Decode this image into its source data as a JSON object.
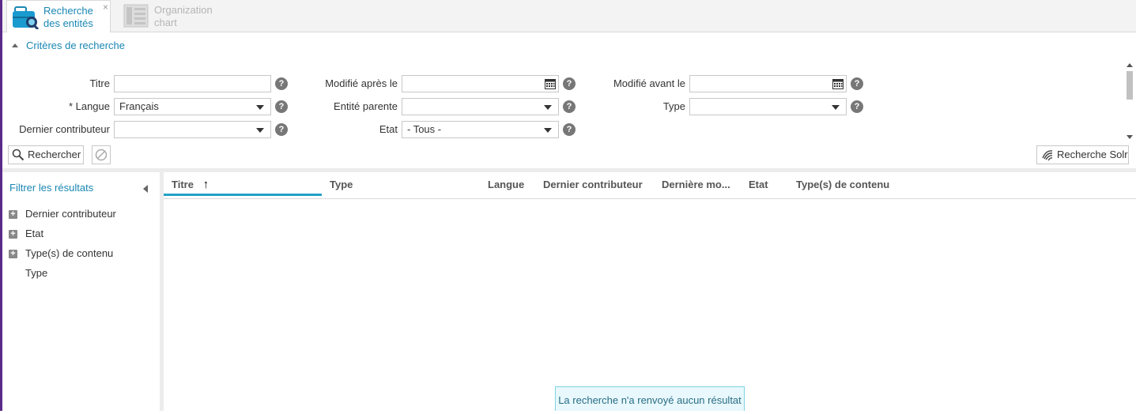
{
  "tabs": [
    {
      "label_line1": "Recherche",
      "label_line2": "des entités",
      "close": "×"
    },
    {
      "label_line1": "Organization",
      "label_line2": "chart"
    }
  ],
  "criteria": {
    "toggle_label": "Critères de recherche",
    "fields": {
      "titre": {
        "label": "Titre",
        "value": ""
      },
      "langue": {
        "label": "* Langue",
        "value": "Français"
      },
      "dernier_contributeur": {
        "label": "Dernier contributeur",
        "value": ""
      },
      "modifie_apres": {
        "label": "Modifié après le",
        "value": ""
      },
      "entite_parente": {
        "label": "Entité parente",
        "value": ""
      },
      "etat": {
        "label": "Etat",
        "value": "- Tous -"
      },
      "modifie_avant": {
        "label": "Modifié avant le",
        "value": ""
      },
      "type": {
        "label": "Type",
        "value": ""
      }
    },
    "help_glyph": "?"
  },
  "actions": {
    "search_label": "Rechercher",
    "solr_label": "Recherche Solr"
  },
  "filter_panel": {
    "title": "Filtrer les résultats",
    "items": [
      {
        "label": "Dernier contributeur",
        "expandable": true
      },
      {
        "label": "Etat",
        "expandable": true
      },
      {
        "label": "Type(s) de contenu",
        "expandable": true
      },
      {
        "label": "Type",
        "expandable": false
      }
    ],
    "plus_glyph": "+"
  },
  "grid": {
    "columns": [
      "Titre",
      "Type",
      "Langue",
      "Dernier contributeur",
      "Dernière mo...",
      "Etat",
      "Type(s) de contenu"
    ],
    "sort_arrow": "↑",
    "sorted_column": "Titre",
    "empty_message": "La recherche n'a renvoyé aucun résultat"
  },
  "colors": {
    "accent": "#1a87b3",
    "sort_underline": "#23a0c9",
    "frame": "#5a2a8a"
  }
}
